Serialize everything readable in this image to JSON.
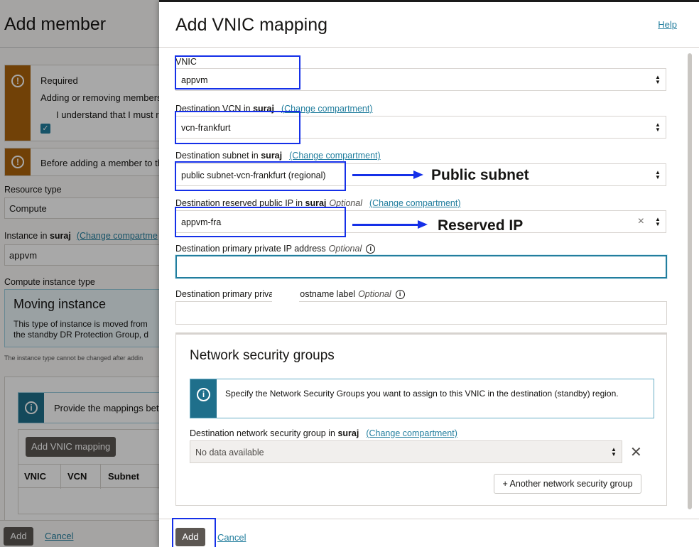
{
  "background": {
    "title": "Add member",
    "alert_required": {
      "heading": "Required",
      "text": "Adding or removing members",
      "checkbox_label": "I understand that I must re"
    },
    "alert_before": {
      "text": "Before adding a member to th"
    },
    "resource_type": {
      "label": "Resource type",
      "value": "Compute"
    },
    "instance": {
      "label_prefix": "Instance in",
      "compartment": "suraj",
      "link": "(Change compartme",
      "value": "appvm"
    },
    "compute_type": {
      "label": "Compute instance type",
      "card_title": "Moving instance",
      "card_line1": "This type of instance is moved from",
      "card_line2": "the standby DR Protection Group, d"
    },
    "small_note": "The instance type cannot be changed after addin",
    "mappings_info": "Provide the mappings betv",
    "add_vnic_button": "Add VNIC mapping",
    "table_headers": [
      "VNIC",
      "VCN",
      "Subnet"
    ],
    "footer": {
      "add": "Add",
      "cancel": "Cancel"
    }
  },
  "drawer": {
    "title": "Add VNIC mapping",
    "help": "Help",
    "vnic": {
      "label": "VNIC",
      "value": "appvm"
    },
    "vcn": {
      "label_prefix": "Destination VCN in",
      "compartment": "suraj",
      "link": "(Change compartment)",
      "value": "vcn-frankfurt"
    },
    "subnet": {
      "label_prefix": "Destination subnet in",
      "compartment": "suraj",
      "link": "(Change compartment)",
      "value": "public subnet-vcn-frankfurt (regional)"
    },
    "reserved_ip": {
      "label_prefix": "Destination reserved public IP in",
      "compartment": "suraj",
      "optional": "Optional",
      "link": "(Change compartment)",
      "value": "appvm-fra"
    },
    "private_ip": {
      "label": "Destination primary private IP address",
      "optional": "Optional",
      "value": ""
    },
    "hostname": {
      "label_part1": "Destination primary priva",
      "label_part2": "ostname label",
      "optional": "Optional",
      "value": ""
    },
    "nsg": {
      "title": "Network security groups",
      "info": "Specify the Network Security Groups you want to assign to this VNIC in the destination (standby) region.",
      "label_prefix": "Destination network security group in",
      "compartment": "suraj",
      "link": "(Change compartment)",
      "placeholder": "No data available",
      "add_another": "+ Another network security group"
    },
    "footer": {
      "add": "Add",
      "cancel": "Cancel"
    }
  },
  "annotations": {
    "public_subnet": "Public subnet",
    "reserved_ip": "Reserved IP",
    "highlight_color": "#1530e8"
  },
  "colors": {
    "link": "#227e9e",
    "warning": "#ac630c",
    "info": "#1f6f8b",
    "primary_button": "#5c5752"
  }
}
